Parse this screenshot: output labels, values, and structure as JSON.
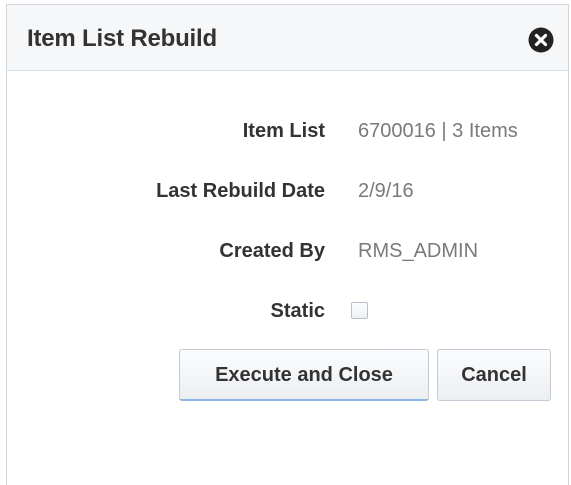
{
  "dialog": {
    "title": "Item List Rebuild",
    "close_icon": "close-circle-icon"
  },
  "fields": {
    "item_list": {
      "label": "Item List",
      "value": "6700016 | 3 Items"
    },
    "last_rebuild_date": {
      "label": "Last Rebuild Date",
      "value": "2/9/16"
    },
    "created_by": {
      "label": "Created By",
      "value": "RMS_ADMIN"
    },
    "static": {
      "label": "Static",
      "checked": false
    }
  },
  "buttons": {
    "execute_label": "Execute and Close",
    "cancel_label": "Cancel"
  },
  "colors": {
    "header_bg": "#f5f7f9",
    "label_text": "#333333",
    "value_text": "#7a7a7a",
    "focus_accent": "#8cb5e6"
  }
}
